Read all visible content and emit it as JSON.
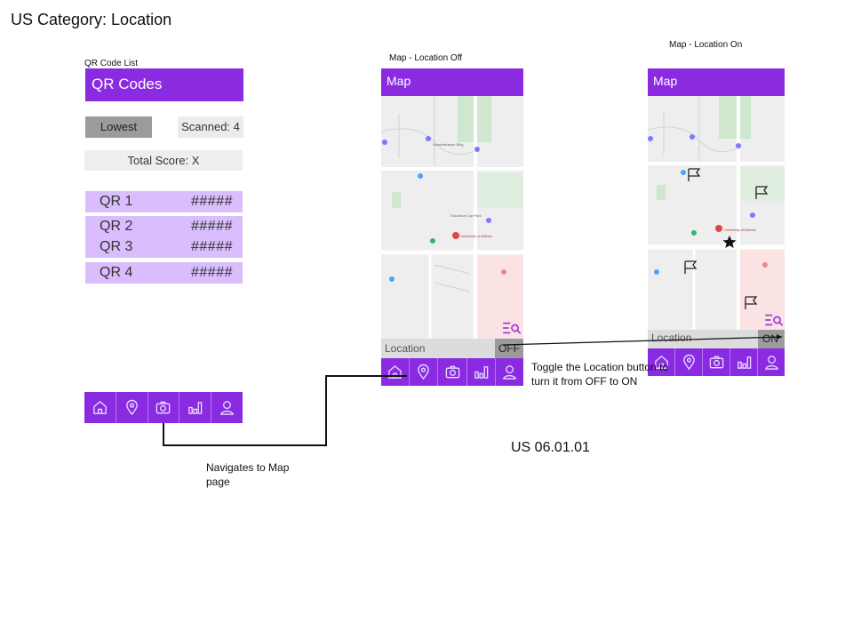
{
  "page_title": "US Category: Location",
  "story_id": "US 06.01.01",
  "qr_list": {
    "caption": "QR Code List",
    "header": "QR Codes",
    "sort_button": "Lowest",
    "scanned": "Scanned: 4",
    "total_score": "Total Score: X",
    "items": [
      {
        "name": "QR 1",
        "score": "#####"
      },
      {
        "name": "QR 2",
        "score": "#####"
      },
      {
        "name": "QR 3",
        "score": "#####"
      },
      {
        "name": "QR 4",
        "score": "#####"
      }
    ]
  },
  "map_off": {
    "caption": "Map - Location Off",
    "header": "Map",
    "location_label": "Location",
    "toggle": "OFF"
  },
  "map_on": {
    "caption": "Map - Location On",
    "header": "Map",
    "location_label": "Location",
    "toggle": "ON"
  },
  "annotations": {
    "navigate": "Navigates to Map page",
    "toggle": "Toggle the Location button to turn it from OFF to ON"
  },
  "map_labels": {
    "building": "Central Academic Building (CAB)",
    "sub": "Students' Union Building",
    "admin": "Administration Bldg",
    "arena": "Clare Drake Arena",
    "carpark": "Education Car Park",
    "uofa": "University of Alberta",
    "ruth": "Rutherford University Of Alberta",
    "katz": "Katz Group Centre for Pharmacy"
  },
  "nav_icons": [
    "home-icon",
    "location-pin-icon",
    "camera-icon",
    "leaderboard-icon",
    "profile-icon"
  ],
  "colors": {
    "brand_purple": "#8a2be2",
    "list_row": "#d9bdfd",
    "toggle_gray": "#9b9b9b"
  }
}
